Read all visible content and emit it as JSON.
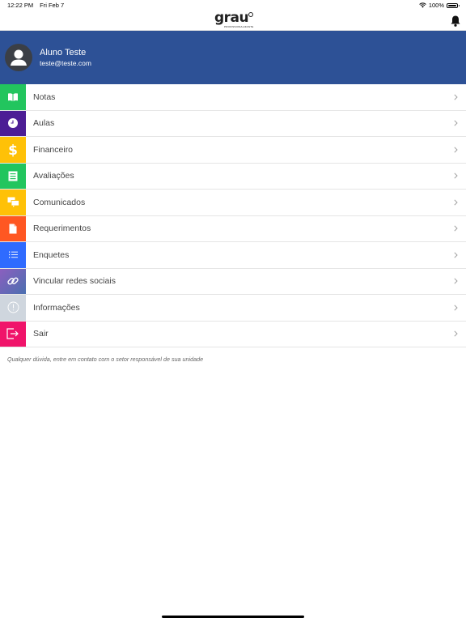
{
  "status_bar": {
    "time": "12:22 PM",
    "date": "Fri Feb 7",
    "battery": "100%",
    "battery_level": 1.0
  },
  "nav": {
    "logo_text": "grau",
    "logo_subtext": "PROFISSIONALIZANTE"
  },
  "profile": {
    "name": "Aluno Teste",
    "email": "teste@teste.com"
  },
  "menu": [
    {
      "label": "Notas",
      "color": "#22c55e",
      "icon": "book-icon"
    },
    {
      "label": "Aulas",
      "color": "#4c1d95",
      "icon": "clock-icon"
    },
    {
      "label": "Financeiro",
      "color": "#ffc107",
      "icon": "dollar-icon"
    },
    {
      "label": "Avaliações",
      "color": "#22c55e",
      "icon": "list-icon"
    },
    {
      "label": "Comunicados",
      "color": "#ffc107",
      "icon": "chat-icon"
    },
    {
      "label": "Requerimentos",
      "color": "#ff5722",
      "icon": "document-icon"
    },
    {
      "label": "Enquetes",
      "color": "#2f6bff",
      "icon": "poll-icon"
    },
    {
      "label": "Vincular redes sociais",
      "color": "#6d5a9c",
      "icon": "link-icon"
    },
    {
      "label": "Informações",
      "color": "#cfd6de",
      "icon": "info-icon"
    },
    {
      "label": "Sair",
      "color": "#f0146a",
      "icon": "logout-icon"
    }
  ],
  "footer_note": "Qualquer dúvida, entre em contato com o setor responsável de sua unidade"
}
